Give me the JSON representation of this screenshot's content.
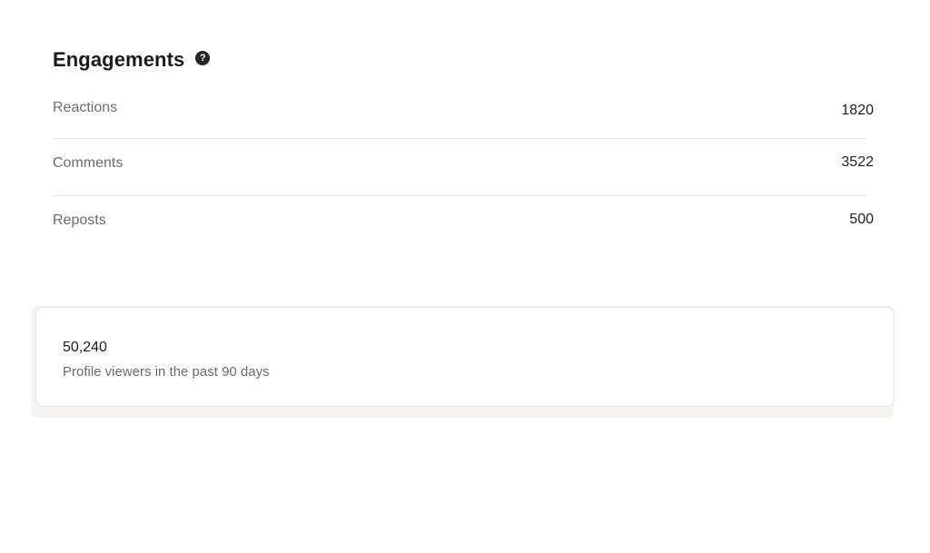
{
  "engagements": {
    "title": "Engagements",
    "help_icon": "question-circle-icon",
    "metrics": [
      {
        "label": "Reactions",
        "value": "1820"
      },
      {
        "label": "Comments",
        "value": "3522"
      },
      {
        "label": "Reposts",
        "value": "500"
      }
    ]
  },
  "profile_viewers": {
    "count": "50,240",
    "caption": "Profile viewers in the past 90 days"
  },
  "colors": {
    "title_text": "#1b1b1b",
    "label_text": "#6b6b6b",
    "divider": "#e3e3e3",
    "card_border": "#e4e4e4",
    "help_icon_bg": "#262626"
  }
}
